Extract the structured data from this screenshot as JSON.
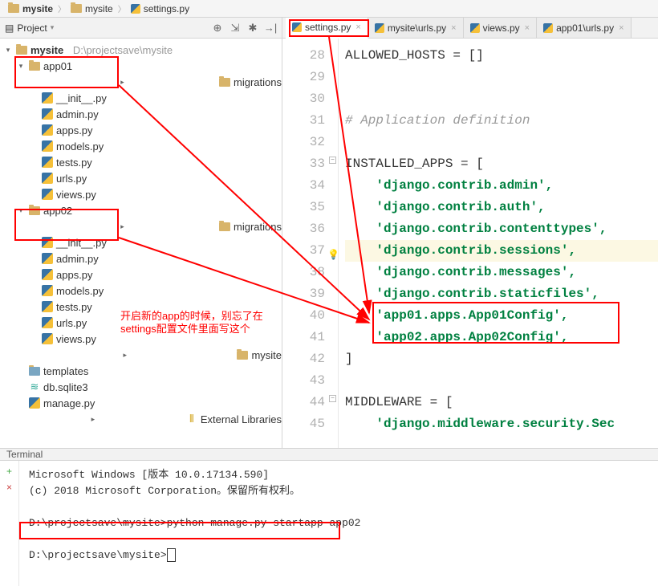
{
  "breadcrumb": {
    "root": "mysite",
    "folder": "mysite",
    "file": "settings.py"
  },
  "project_panel": {
    "title": "Project"
  },
  "tree": {
    "root": "mysite",
    "root_path": "D:\\projectsave\\mysite",
    "app01": "app01",
    "app01_migrations": "migrations",
    "init": "__init__.py",
    "admin": "admin.py",
    "apps": "apps.py",
    "models": "models.py",
    "tests": "tests.py",
    "urls": "urls.py",
    "views": "views.py",
    "app02": "app02",
    "app02_migrations": "migrations",
    "mysite_pkg": "mysite",
    "templates": "templates",
    "db": "db.sqlite3",
    "manage": "manage.py",
    "external": "External Libraries"
  },
  "tabs": {
    "t1": "settings.py",
    "t2": "mysite\\urls.py",
    "t3": "views.py",
    "t4": "app01\\urls.py"
  },
  "code": {
    "l28": "ALLOWED_HOSTS = []",
    "l31": "# Application definition",
    "l33": "INSTALLED_APPS = [",
    "l34": "'django.contrib.admin',",
    "l35": "'django.contrib.auth',",
    "l36": "'django.contrib.contenttypes',",
    "l37": "'django.contrib.sessions',",
    "l38": "'django.contrib.messages',",
    "l39": "'django.contrib.staticfiles',",
    "l40": "'app01.apps.App01Config',",
    "l41": "'app02.apps.App02Config',",
    "l42": "]",
    "l44": "MIDDLEWARE = [",
    "l45": "'django.middleware.security.Sec"
  },
  "gutter": [
    "28",
    "29",
    "30",
    "31",
    "32",
    "33",
    "34",
    "35",
    "36",
    "37",
    "38",
    "39",
    "40",
    "41",
    "42",
    "43",
    "44",
    "45"
  ],
  "annotation": {
    "line1": "开启新的app的时候，别忘了在",
    "line2": "settings配置文件里面写这个"
  },
  "terminal": {
    "title": "Terminal",
    "line1": "Microsoft Windows [版本 10.0.17134.590]",
    "line2": "(c) 2018 Microsoft Corporation。保留所有权利。",
    "cmd": "D:\\projectsave\\mysite>python manage.py startapp app02",
    "prompt": "D:\\projectsave\\mysite>"
  },
  "chart_data": null
}
